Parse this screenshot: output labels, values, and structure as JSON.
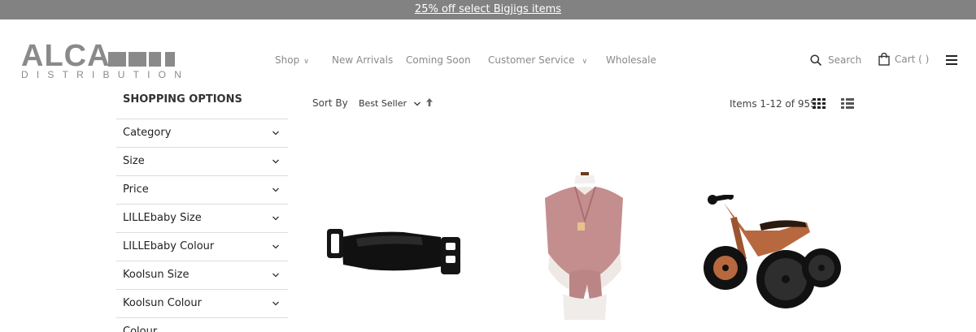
{
  "promo": {
    "text": "25% off select Bigjigs items"
  },
  "brand": {
    "name": "ALCA",
    "tagline": "DISTRIBUTION",
    "color": "#8a8a8a"
  },
  "nav": {
    "items": [
      {
        "label": "Shop",
        "has_dropdown": true
      },
      {
        "label": "New Arrivals",
        "has_dropdown": false
      },
      {
        "label": "Coming Soon",
        "has_dropdown": false
      },
      {
        "label": "Customer Service",
        "has_dropdown": true
      },
      {
        "label": "Wholesale",
        "has_dropdown": false
      }
    ]
  },
  "header": {
    "search_label": "Search",
    "cart_label": "Cart ( )"
  },
  "sidebar": {
    "title": "SHOPPING OPTIONS",
    "filters": [
      {
        "label": "Category"
      },
      {
        "label": "Size"
      },
      {
        "label": "Price"
      },
      {
        "label": "LILLEbaby Size"
      },
      {
        "label": "LILLEbaby Colour"
      },
      {
        "label": "Koolsun Size"
      },
      {
        "label": "Koolsun Colour"
      },
      {
        "label": "Colour"
      }
    ]
  },
  "toolbar": {
    "sort_label": "Sort By",
    "sort_value": "Best Seller",
    "item_count": "Items 1-12 of 955"
  },
  "colors": {
    "promo_bg": "#828282",
    "nav_text": "#8a8a8a",
    "divider": "#dcdcdc",
    "wrap_pink": "#c48e8e",
    "bike_wood": "#b8683e"
  },
  "products": [
    {
      "image": "black-buckle-strap-icon"
    },
    {
      "image": "pink-baby-wrap-carrier-icon"
    },
    {
      "image": "wooden-balance-trike-icon"
    }
  ]
}
